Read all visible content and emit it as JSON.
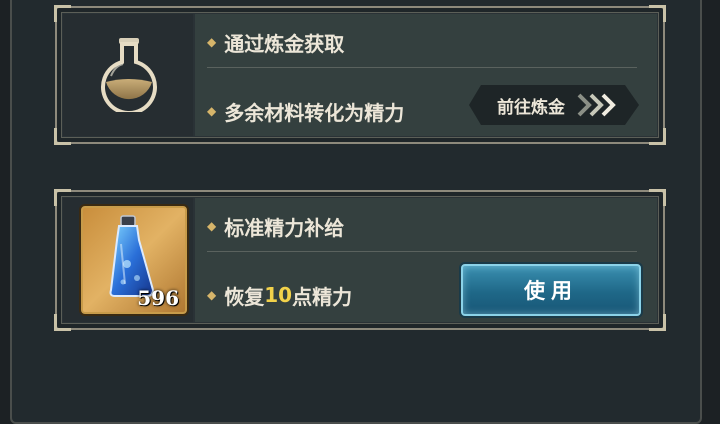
{
  "alchemy_card": {
    "title": "通过炼金获取",
    "desc": "多余材料转化为精力",
    "goto_label": "前往炼金",
    "icon": "flask-icon"
  },
  "supply_card": {
    "title": "标准精力补给",
    "desc_prefix": "恢复",
    "desc_amount": "10",
    "desc_suffix": "点精力",
    "item_count": "596",
    "use_label": "使用",
    "icon": "energy-potion-icon"
  },
  "colors": {
    "highlight": "#f2d24a",
    "use_button": "#1f6888",
    "bullet": "#d6b56a"
  }
}
